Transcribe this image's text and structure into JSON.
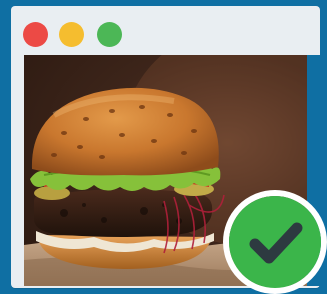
{
  "window": {
    "controls": [
      {
        "name": "close",
        "color": "#ec4a45"
      },
      {
        "name": "minimize",
        "color": "#f5bd2f"
      },
      {
        "name": "maximize",
        "color": "#4cb756"
      }
    ]
  },
  "image": {
    "subject": "burger-photo"
  },
  "badge": {
    "icon": "checkmark-icon",
    "color": "#3bb54a",
    "check_color": "#2d3a40"
  },
  "theme": {
    "background": "#0f6fa3",
    "window": "#e9eef2"
  }
}
